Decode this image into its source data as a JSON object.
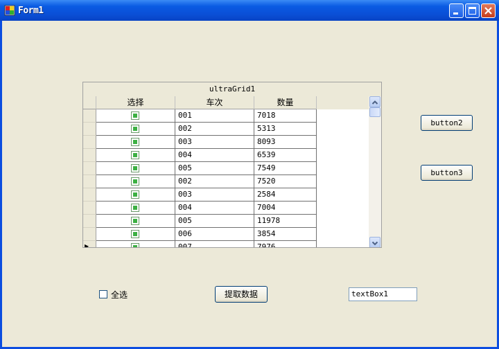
{
  "window": {
    "title": "Form1"
  },
  "grid": {
    "caption": "ultraGrid1",
    "columns": [
      "选择",
      "车次",
      "数量"
    ],
    "rows": [
      {
        "checked": true,
        "car": "001",
        "qty": "7018"
      },
      {
        "checked": true,
        "car": "002",
        "qty": "5313"
      },
      {
        "checked": true,
        "car": "003",
        "qty": "8093"
      },
      {
        "checked": true,
        "car": "004",
        "qty": "6539"
      },
      {
        "checked": true,
        "car": "005",
        "qty": "7549"
      },
      {
        "checked": true,
        "car": "002",
        "qty": "7520"
      },
      {
        "checked": true,
        "car": "003",
        "qty": "2584"
      },
      {
        "checked": true,
        "car": "004",
        "qty": "7004"
      },
      {
        "checked": true,
        "car": "005",
        "qty": "11978"
      },
      {
        "checked": true,
        "car": "006",
        "qty": "3854"
      },
      {
        "checked": true,
        "car": "007",
        "qty": "7976"
      }
    ]
  },
  "buttons": {
    "button2": "button2",
    "button3": "button3",
    "fetch": "提取数据"
  },
  "select_all": {
    "label": "全选",
    "checked": false
  },
  "textbox": {
    "value": "textBox1"
  }
}
